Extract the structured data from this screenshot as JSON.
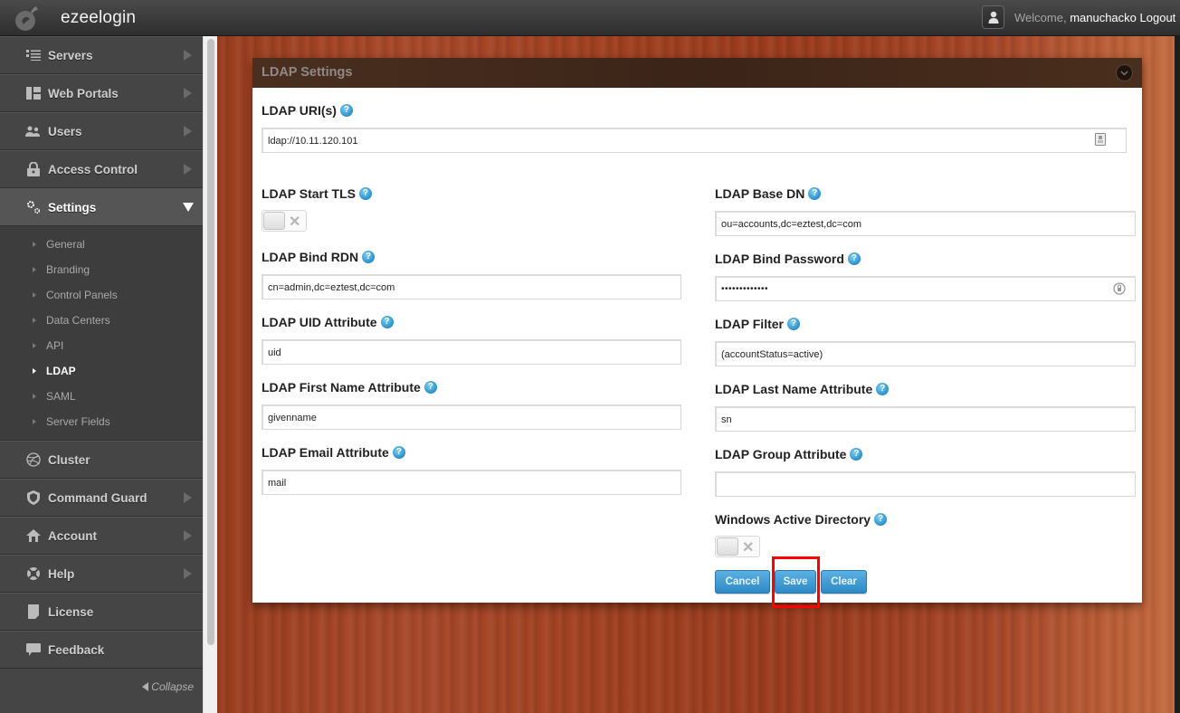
{
  "header": {
    "brand": "ezeelogin",
    "welcome_prefix": "Welcome,",
    "username": "manuchacko",
    "logout_label": "Logout"
  },
  "sidebar": {
    "items": [
      {
        "label": "Servers",
        "icon": "list-icon",
        "has_arrow": true
      },
      {
        "label": "Web Portals",
        "icon": "layout-icon",
        "has_arrow": true
      },
      {
        "label": "Users",
        "icon": "users-icon",
        "has_arrow": true
      },
      {
        "label": "Access Control",
        "icon": "lock-icon",
        "has_arrow": true
      },
      {
        "label": "Settings",
        "icon": "gears-icon",
        "expanded": true
      }
    ],
    "settings_submenu": [
      {
        "label": "General"
      },
      {
        "label": "Branding"
      },
      {
        "label": "Control Panels"
      },
      {
        "label": "Data Centers"
      },
      {
        "label": "API"
      },
      {
        "label": "LDAP",
        "active": true
      },
      {
        "label": "SAML"
      },
      {
        "label": "Server Fields"
      }
    ],
    "items_after": [
      {
        "label": "Cluster",
        "icon": "dribbble-icon",
        "has_arrow": false
      },
      {
        "label": "Command Guard",
        "icon": "shield-icon",
        "has_arrow": true
      },
      {
        "label": "Account",
        "icon": "home-icon",
        "has_arrow": true
      },
      {
        "label": "Help",
        "icon": "lifebuoy-icon",
        "has_arrow": true
      },
      {
        "label": "License",
        "icon": "document-icon",
        "has_arrow": false
      },
      {
        "label": "Feedback",
        "icon": "comment-icon",
        "has_arrow": false
      }
    ],
    "collapse_label": "Collapse"
  },
  "panel": {
    "title": "LDAP Settings",
    "fields": {
      "uri": {
        "label": "LDAP URI(s)",
        "value": "ldap://10.11.120.101"
      },
      "start_tls": {
        "label": "LDAP Start TLS",
        "enabled": false
      },
      "base_dn": {
        "label": "LDAP Base DN",
        "value": "ou=accounts,dc=eztest,dc=com"
      },
      "bind_rdn": {
        "label": "LDAP Bind RDN",
        "value": "cn=admin,dc=eztest,dc=com"
      },
      "bind_password": {
        "label": "LDAP Bind Password",
        "value": "•••••••••••••"
      },
      "uid_attr": {
        "label": "LDAP UID Attribute",
        "value": "uid"
      },
      "filter": {
        "label": "LDAP Filter",
        "value": "(accountStatus=active)"
      },
      "first_name_attr": {
        "label": "LDAP First Name Attribute",
        "value": "givenname"
      },
      "last_name_attr": {
        "label": "LDAP Last Name Attribute",
        "value": "sn"
      },
      "email_attr": {
        "label": "LDAP Email Attribute",
        "value": "mail"
      },
      "group_attr": {
        "label": "LDAP Group Attribute",
        "value": ""
      },
      "windows_ad": {
        "label": "Windows Active Directory",
        "enabled": false
      }
    },
    "buttons": {
      "cancel": "Cancel",
      "save": "Save",
      "clear": "Clear"
    },
    "help_glyph": "?",
    "toggle_off_glyph": "✕"
  },
  "colors": {
    "accent_button": "#3a96d2",
    "highlight": "#ff0000",
    "topbar": "#3a3a3a",
    "sidebar": "#454545"
  }
}
